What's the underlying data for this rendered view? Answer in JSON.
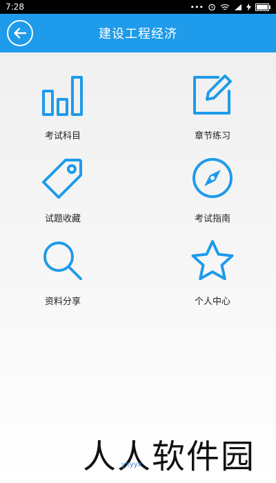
{
  "status_bar": {
    "time": "7:28",
    "icons": [
      "more-dots",
      "alarm-icon",
      "wifi-icon",
      "signal-icon",
      "charging-icon",
      "battery-icon"
    ]
  },
  "app_bar": {
    "title": "建设工程经济",
    "back_icon": "back-arrow-icon",
    "color": "#1e9bea"
  },
  "menu": {
    "icon_color": "#1e9bea",
    "items": [
      {
        "label": "考试科目",
        "icon": "bar-chart-icon"
      },
      {
        "label": "章节练习",
        "icon": "edit-icon"
      },
      {
        "label": "试题收藏",
        "icon": "tag-icon"
      },
      {
        "label": "考试指南",
        "icon": "compass-icon"
      },
      {
        "label": "资料分享",
        "icon": "search-icon"
      },
      {
        "label": "个人中心",
        "icon": "star-icon"
      }
    ]
  },
  "watermark": {
    "text": "人人软件园",
    "subtext": "yxyyx"
  }
}
